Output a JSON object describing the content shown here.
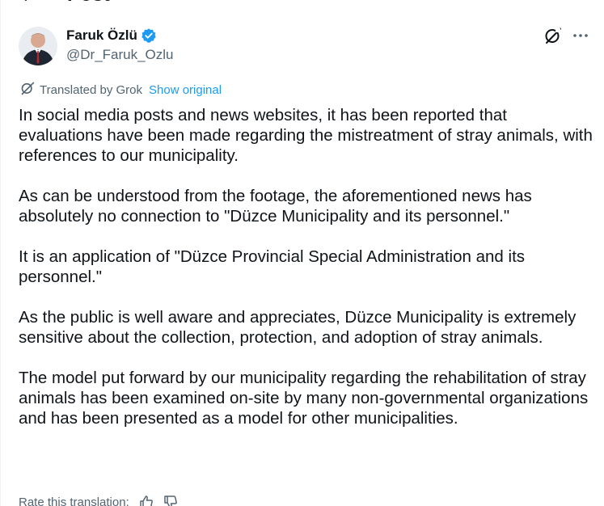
{
  "header": {
    "title": "Post"
  },
  "author": {
    "name": "Faruk Özlü",
    "handle": "@Dr_Faruk_Ozlu",
    "verified": true
  },
  "translation": {
    "label": "Translated by Grok",
    "show_original": "Show original"
  },
  "post": {
    "paragraphs": [
      "In social media posts and news websites, it has been reported that evaluations have been made regarding the mistreatment of stray animals, with references to our municipality.",
      "As can be understood from the footage, the aforementioned news has absolutely no connection to \"Düzce Municipality and its personnel.\"",
      "It is an application of \"Düzce Provincial Special Administration and its personnel.\"",
      "As the public is well aware and appreciates, Düzce Municipality is extremely sensitive about the collection, protection, and adoption of stray animals.",
      "The model put forward by our municipality regarding the rehabilitation of stray animals has been examined on-site by many non-governmental organizations and has been presented as a model for other municipalities."
    ]
  },
  "rating": {
    "label": "Rate this translation:"
  },
  "colors": {
    "accent": "#1d9bf0",
    "text": "#0f1419",
    "secondary": "#536471"
  },
  "icons": {
    "back": "back-arrow-icon",
    "verified": "verified-badge-icon",
    "grok": "grok-icon",
    "more": "more-icon",
    "thumbs_up": "thumbs-up-icon",
    "thumbs_down": "thumbs-down-icon"
  }
}
